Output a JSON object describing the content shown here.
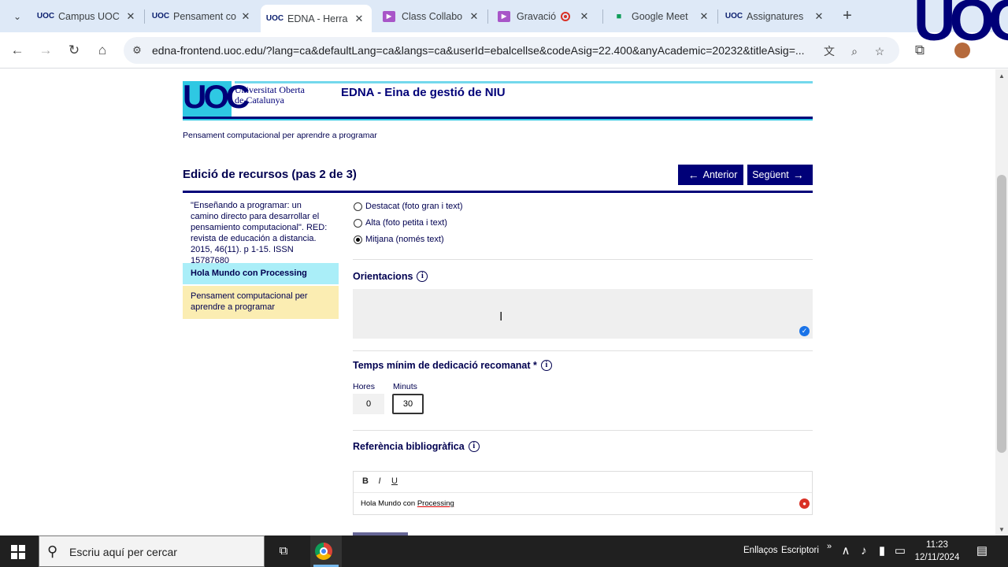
{
  "browser": {
    "tabs": [
      {
        "label": "Campus UOC",
        "icon": "uoc-icon"
      },
      {
        "label": "Pensament co",
        "icon": "uoc-icon"
      },
      {
        "label": "EDNA - Herra",
        "icon": "uoc-icon",
        "active": true
      },
      {
        "label": "Class Collabo",
        "icon": "video-icon"
      },
      {
        "label": "Gravació",
        "icon": "video-icon"
      },
      {
        "label": "Google Meet",
        "icon": "meet-icon"
      },
      {
        "label": "Assignatures",
        "icon": "uoc-icon"
      }
    ],
    "url": "edna-frontend.uoc.edu/?lang=ca&defaultLang=ca&langs=ca&userId=ebalcellse&codeAsig=22.400&anyAcademic=20232&titleAsig=..."
  },
  "header": {
    "logo_text": "UOC",
    "university_name_line1": "Universitat Oberta",
    "university_name_line2": "de Catalunya",
    "app_title": "EDNA - Eina de gestió de NIU",
    "subject": "Pensament computacional per aprendre a programar"
  },
  "step": {
    "title": "Edició de recursos (pas 2 de 3)",
    "prev_label": "Anterior",
    "next_label": "Següent"
  },
  "sidebar": {
    "items": [
      {
        "label": "\"Enseñando a programar: un camino directo para desarrollar el pensamiento computacional\". RED: revista de educación a distancia. 2015, 46(11). p 1-15. ISSN 15787680"
      },
      {
        "label": "Hola Mundo con Processing"
      },
      {
        "label": "Pensament computacional per aprendre a programar"
      }
    ]
  },
  "form": {
    "display_options": [
      {
        "label": "Destacat (foto gran i text)",
        "selected": false
      },
      {
        "label": "Alta (foto petita i text)",
        "selected": false
      },
      {
        "label": "Mitjana (només text)",
        "selected": true
      }
    ],
    "orientacions_label": "Orientacions",
    "orientacions_value": "",
    "temps_label": "Temps mínim de dedicació recomanat *",
    "hores_label": "Hores",
    "hores_value": "0",
    "minuts_label": "Minuts",
    "minuts_value": "30",
    "referencia_label": "Referència bibliogràfica",
    "referencia_text_plain": "Hola Mundo con ",
    "referencia_text_spell": "Processing",
    "rte_buttons": [
      "B",
      "I",
      "U"
    ]
  },
  "taskbar": {
    "search_placeholder": "Escriu aquí per cercar",
    "tray_links": "Enllaços",
    "tray_desktop": "Escriptori",
    "time": "11:23",
    "date": "12/11/2024"
  },
  "overlay": {
    "logo_text": "UOC"
  },
  "colors": {
    "brand_blue": "#000078",
    "brand_cyan": "#2ec8e3",
    "selected_item": "#aaeef8",
    "highlight_item": "#fbedb2"
  }
}
